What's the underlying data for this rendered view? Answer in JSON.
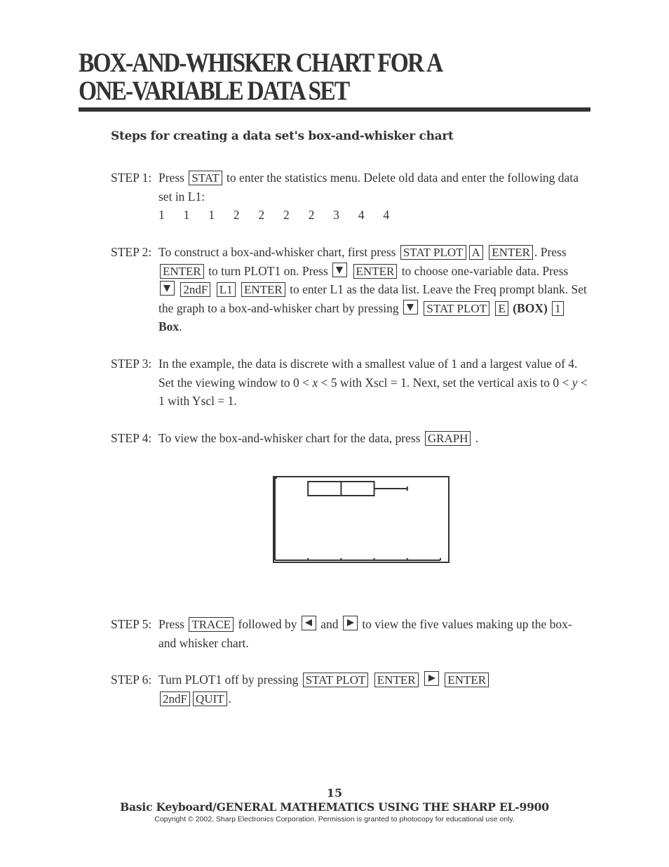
{
  "title": {
    "line1": "BOX-AND-WHISKER CHART FOR A",
    "line2": "ONE-VARIABLE DATA SET"
  },
  "subheading": "Steps for creating a data set's box-and-whisker chart",
  "steps": {
    "s1": {
      "label": "STEP 1:",
      "t1": "Press",
      "k1": "STAT",
      "t2": "to enter the statistics menu.  Delete old data and enter the following data set in L1:",
      "data": [
        "1",
        "1",
        "1",
        "2",
        "2",
        "2",
        "2",
        "3",
        "4",
        "4"
      ]
    },
    "s2": {
      "label": "STEP 2:",
      "t1": "To construct a box-and-whisker chart, first press",
      "k1": "STAT PLOT",
      "k2": "A",
      "k3": "ENTER",
      "t2": ".  Press",
      "k4": "ENTER",
      "t3": "to turn PLOT1 on.  Press",
      "k5": "ENTER",
      "t4": "to choose one-variable data.  Press",
      "k6": "2ndF",
      "k7": "L1",
      "k8": "ENTER",
      "t5": "to enter L1 as the data list.  Leave the Freq prompt blank.  Set the graph to a box-and-whisker chart by pressing",
      "k9": "STAT PLOT",
      "k10": "E",
      "t6": "(BOX)",
      "k11": "1",
      "t7": "Box",
      "t8": "."
    },
    "s3": {
      "label": "STEP 3:",
      "t1": "In the example, the data is discrete with a smallest value of 1 and a largest value of 4.  Set the viewing window to 0 <",
      "x": "x",
      "t2": "< 5 with Xscl = 1.  Next, set the vertical axis to 0 <",
      "y": "y",
      "t3": "< 1 with Yscl = 1."
    },
    "s4": {
      "label": "STEP 4:",
      "t1": "To view the box-and-whisker chart for the data, press",
      "k1": "GRAPH",
      "t2": "."
    },
    "s5": {
      "label": "STEP 5:",
      "t1": "Press",
      "k1": "TRACE",
      "t2": "followed by",
      "t3": "and",
      "t4": "to view the five values making up the box-and whisker chart."
    },
    "s6": {
      "label": "STEP 6:",
      "t1": "Turn PLOT1 off by pressing",
      "k1": "STAT PLOT",
      "k2": "ENTER",
      "k3": "ENTER",
      "k4": "2ndF",
      "k5": "QUIT",
      "t2": "."
    }
  },
  "chart_data": {
    "type": "box",
    "title": "",
    "xlabel": "",
    "ylabel": "",
    "xlim": [
      0,
      5
    ],
    "ylim": [
      0,
      1
    ],
    "xscl": 1,
    "yscl": 1,
    "x_ticks": [
      1,
      2,
      3,
      4
    ],
    "data": [
      1,
      1,
      1,
      2,
      2,
      2,
      2,
      3,
      4,
      4
    ],
    "box": {
      "min": 1,
      "q1": 1,
      "median": 2,
      "q3": 3,
      "max": 4
    },
    "grid": false
  },
  "footer": {
    "page_number": "15",
    "book_title": "Basic Keyboard/GENERAL MATHEMATICS USING THE SHARP EL-9900",
    "copyright": "Copyright © 2002, Sharp Electronics Corporation.  Permission is granted to photocopy for educational use only."
  }
}
